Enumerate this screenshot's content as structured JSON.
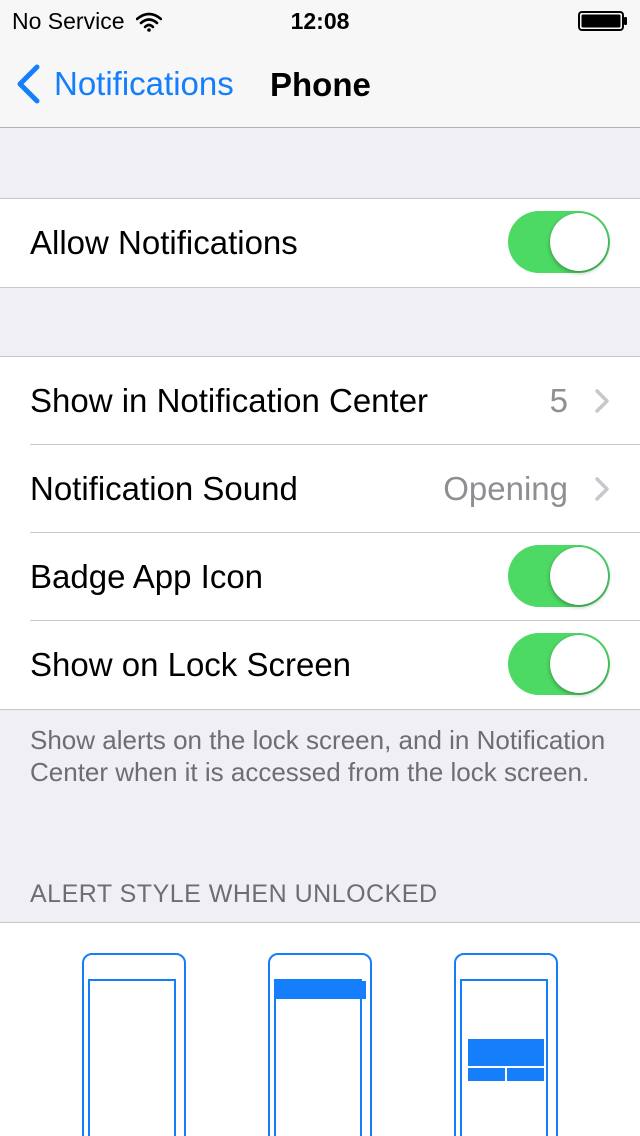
{
  "status_bar": {
    "carrier": "No Service",
    "time": "12:08"
  },
  "nav": {
    "back_label": "Notifications",
    "title": "Phone"
  },
  "allow_group": {
    "allow_notifications": {
      "label": "Allow Notifications",
      "on": true
    }
  },
  "settings_group": {
    "rows": [
      {
        "label": "Show in Notification Center",
        "value": "5"
      },
      {
        "label": "Notification Sound",
        "value": "Opening"
      },
      {
        "label": "Badge App Icon",
        "on": true
      },
      {
        "label": "Show on Lock Screen",
        "on": true
      }
    ]
  },
  "footer_note": "Show alerts on the lock screen, and in Notification Center when it is accessed from the lock screen.",
  "alert_style": {
    "header": "ALERT STYLE WHEN UNLOCKED",
    "options": [
      "none",
      "banners",
      "alerts"
    ]
  },
  "colors": {
    "accent": "#157efb",
    "toggle_on": "#4cd964",
    "background": "#efeff4",
    "secondary_text": "#8e8e93"
  }
}
